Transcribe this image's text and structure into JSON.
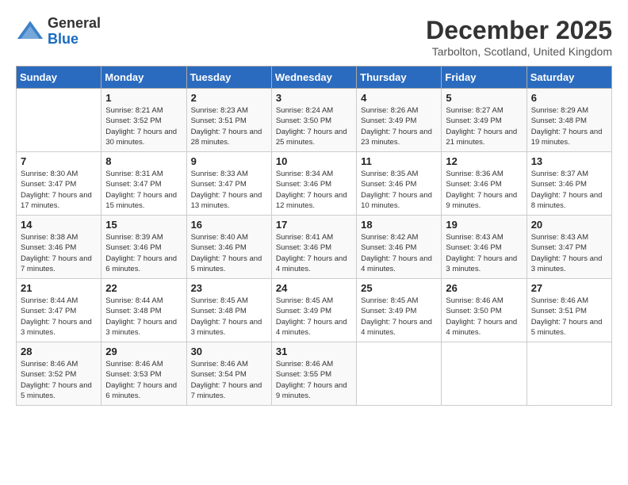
{
  "header": {
    "logo": {
      "line1": "General",
      "line2": "Blue"
    },
    "month": "December 2025",
    "location": "Tarbolton, Scotland, United Kingdom"
  },
  "weekdays": [
    "Sunday",
    "Monday",
    "Tuesday",
    "Wednesday",
    "Thursday",
    "Friday",
    "Saturday"
  ],
  "weeks": [
    [
      {
        "day": "",
        "info": ""
      },
      {
        "day": "1",
        "info": "Sunrise: 8:21 AM\nSunset: 3:52 PM\nDaylight: 7 hours\nand 30 minutes."
      },
      {
        "day": "2",
        "info": "Sunrise: 8:23 AM\nSunset: 3:51 PM\nDaylight: 7 hours\nand 28 minutes."
      },
      {
        "day": "3",
        "info": "Sunrise: 8:24 AM\nSunset: 3:50 PM\nDaylight: 7 hours\nand 25 minutes."
      },
      {
        "day": "4",
        "info": "Sunrise: 8:26 AM\nSunset: 3:49 PM\nDaylight: 7 hours\nand 23 minutes."
      },
      {
        "day": "5",
        "info": "Sunrise: 8:27 AM\nSunset: 3:49 PM\nDaylight: 7 hours\nand 21 minutes."
      },
      {
        "day": "6",
        "info": "Sunrise: 8:29 AM\nSunset: 3:48 PM\nDaylight: 7 hours\nand 19 minutes."
      }
    ],
    [
      {
        "day": "7",
        "info": "Sunrise: 8:30 AM\nSunset: 3:47 PM\nDaylight: 7 hours\nand 17 minutes."
      },
      {
        "day": "8",
        "info": "Sunrise: 8:31 AM\nSunset: 3:47 PM\nDaylight: 7 hours\nand 15 minutes."
      },
      {
        "day": "9",
        "info": "Sunrise: 8:33 AM\nSunset: 3:47 PM\nDaylight: 7 hours\nand 13 minutes."
      },
      {
        "day": "10",
        "info": "Sunrise: 8:34 AM\nSunset: 3:46 PM\nDaylight: 7 hours\nand 12 minutes."
      },
      {
        "day": "11",
        "info": "Sunrise: 8:35 AM\nSunset: 3:46 PM\nDaylight: 7 hours\nand 10 minutes."
      },
      {
        "day": "12",
        "info": "Sunrise: 8:36 AM\nSunset: 3:46 PM\nDaylight: 7 hours\nand 9 minutes."
      },
      {
        "day": "13",
        "info": "Sunrise: 8:37 AM\nSunset: 3:46 PM\nDaylight: 7 hours\nand 8 minutes."
      }
    ],
    [
      {
        "day": "14",
        "info": "Sunrise: 8:38 AM\nSunset: 3:46 PM\nDaylight: 7 hours\nand 7 minutes."
      },
      {
        "day": "15",
        "info": "Sunrise: 8:39 AM\nSunset: 3:46 PM\nDaylight: 7 hours\nand 6 minutes."
      },
      {
        "day": "16",
        "info": "Sunrise: 8:40 AM\nSunset: 3:46 PM\nDaylight: 7 hours\nand 5 minutes."
      },
      {
        "day": "17",
        "info": "Sunrise: 8:41 AM\nSunset: 3:46 PM\nDaylight: 7 hours\nand 4 minutes."
      },
      {
        "day": "18",
        "info": "Sunrise: 8:42 AM\nSunset: 3:46 PM\nDaylight: 7 hours\nand 4 minutes."
      },
      {
        "day": "19",
        "info": "Sunrise: 8:43 AM\nSunset: 3:46 PM\nDaylight: 7 hours\nand 3 minutes."
      },
      {
        "day": "20",
        "info": "Sunrise: 8:43 AM\nSunset: 3:47 PM\nDaylight: 7 hours\nand 3 minutes."
      }
    ],
    [
      {
        "day": "21",
        "info": "Sunrise: 8:44 AM\nSunset: 3:47 PM\nDaylight: 7 hours\nand 3 minutes."
      },
      {
        "day": "22",
        "info": "Sunrise: 8:44 AM\nSunset: 3:48 PM\nDaylight: 7 hours\nand 3 minutes."
      },
      {
        "day": "23",
        "info": "Sunrise: 8:45 AM\nSunset: 3:48 PM\nDaylight: 7 hours\nand 3 minutes."
      },
      {
        "day": "24",
        "info": "Sunrise: 8:45 AM\nSunset: 3:49 PM\nDaylight: 7 hours\nand 4 minutes."
      },
      {
        "day": "25",
        "info": "Sunrise: 8:45 AM\nSunset: 3:49 PM\nDaylight: 7 hours\nand 4 minutes."
      },
      {
        "day": "26",
        "info": "Sunrise: 8:46 AM\nSunset: 3:50 PM\nDaylight: 7 hours\nand 4 minutes."
      },
      {
        "day": "27",
        "info": "Sunrise: 8:46 AM\nSunset: 3:51 PM\nDaylight: 7 hours\nand 5 minutes."
      }
    ],
    [
      {
        "day": "28",
        "info": "Sunrise: 8:46 AM\nSunset: 3:52 PM\nDaylight: 7 hours\nand 5 minutes."
      },
      {
        "day": "29",
        "info": "Sunrise: 8:46 AM\nSunset: 3:53 PM\nDaylight: 7 hours\nand 6 minutes."
      },
      {
        "day": "30",
        "info": "Sunrise: 8:46 AM\nSunset: 3:54 PM\nDaylight: 7 hours\nand 7 minutes."
      },
      {
        "day": "31",
        "info": "Sunrise: 8:46 AM\nSunset: 3:55 PM\nDaylight: 7 hours\nand 9 minutes."
      },
      {
        "day": "",
        "info": ""
      },
      {
        "day": "",
        "info": ""
      },
      {
        "day": "",
        "info": ""
      }
    ]
  ]
}
